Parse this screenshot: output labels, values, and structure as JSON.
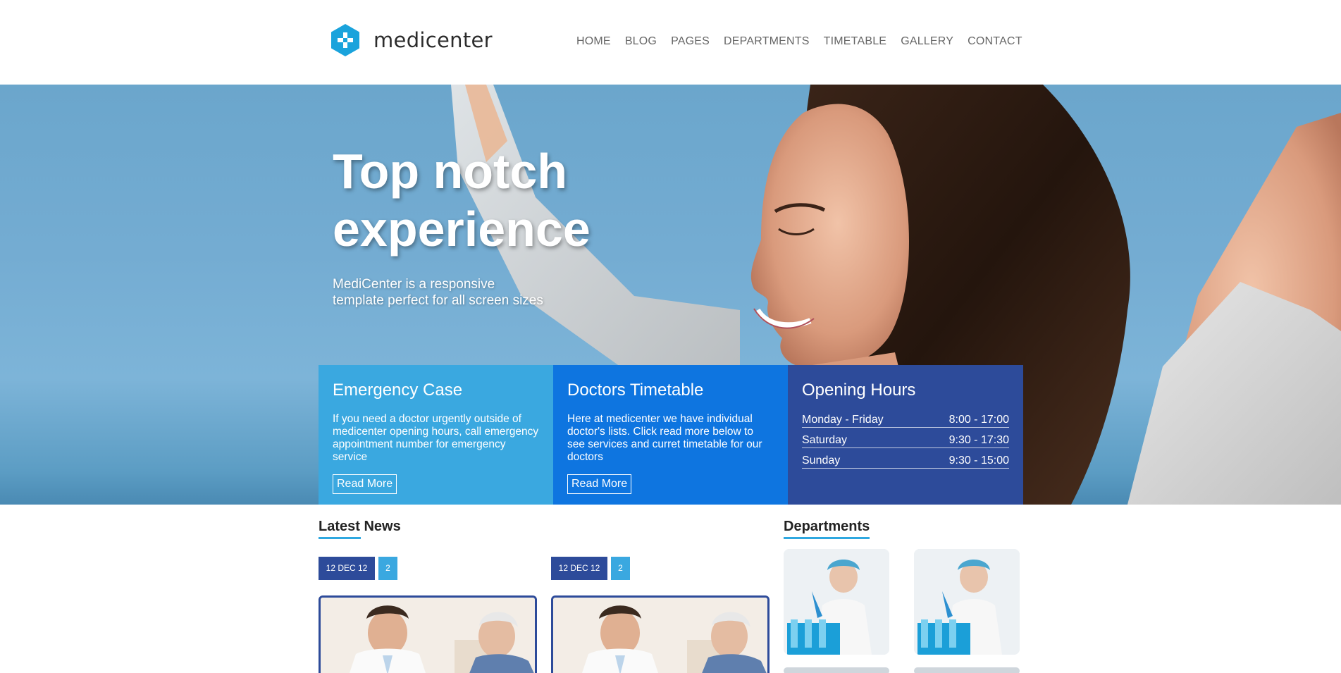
{
  "header": {
    "logo_text": "medicenter",
    "nav": [
      "HOME",
      "BLOG",
      "PAGES",
      "DEPARTMENTS",
      "TIMETABLE",
      "GALLERY",
      "CONTACT"
    ]
  },
  "hero": {
    "title_line1": "Top notch",
    "title_line2": "experience",
    "subtitle_line1": "MediCenter is a responsive",
    "subtitle_line2": "template perfect for all screen sizes"
  },
  "boxes": {
    "emergency": {
      "title": "Emergency Case",
      "text": "If you need a doctor urgently outside of medicenter opening hours, call emergency appointment number for emergency service",
      "button": "Read More"
    },
    "timetable": {
      "title": "Doctors Timetable",
      "text": "Here at medicenter we have individual doctor's lists. Click read more below to see services and curret timetable for our doctors",
      "button": "Read More"
    },
    "hours": {
      "title": "Opening Hours",
      "rows": [
        {
          "day": "Monday - Friday",
          "time": "8:00 - 17:00"
        },
        {
          "day": "Saturday",
          "time": "9:30 - 17:30"
        },
        {
          "day": "Sunday",
          "time": "9:30 - 15:00"
        }
      ]
    }
  },
  "latest_news": {
    "title": "Latest News",
    "items": [
      {
        "date": "12 DEC 12",
        "comments": "2"
      },
      {
        "date": "12 DEC 12",
        "comments": "2"
      }
    ]
  },
  "departments": {
    "title": "Departments"
  },
  "colors": {
    "brand": "#1aa3dc",
    "light_blue": "#3aa8e0",
    "mid_blue": "#0e75e0",
    "dark_blue": "#2d4b9a"
  }
}
